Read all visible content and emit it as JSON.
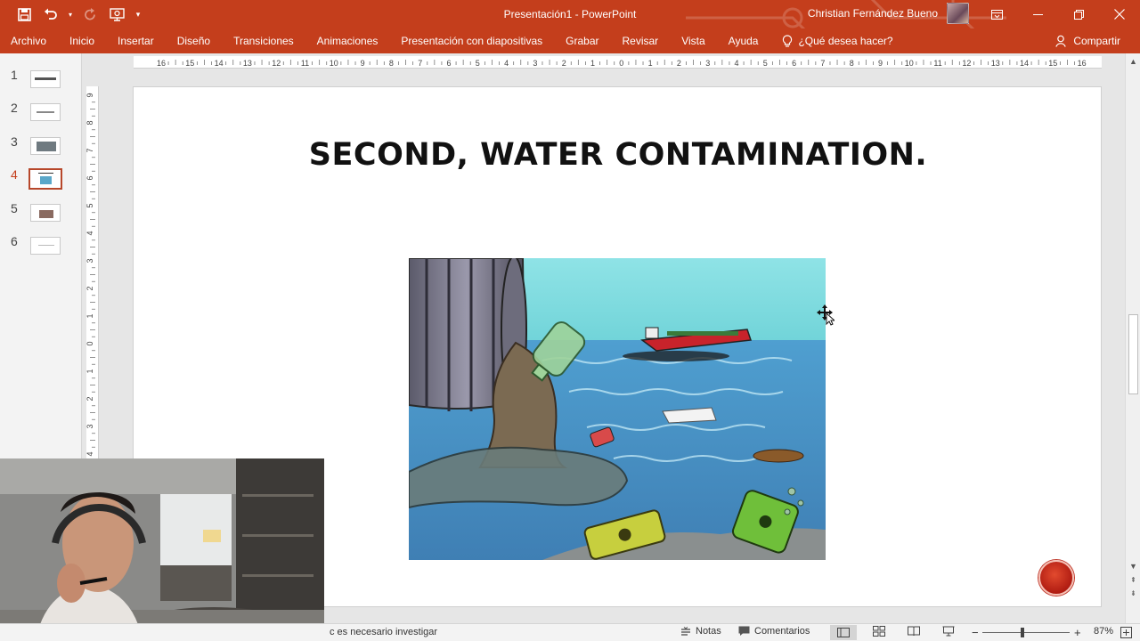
{
  "window": {
    "title": "Presentación1  -  PowerPoint",
    "user_name": "Christian Fernández Bueno"
  },
  "ribbon": {
    "tabs": [
      "Archivo",
      "Inicio",
      "Insertar",
      "Diseño",
      "Transiciones",
      "Animaciones",
      "Presentación con diapositivas",
      "Grabar",
      "Revisar",
      "Vista",
      "Ayuda"
    ],
    "tell_me": "¿Qué desea hacer?",
    "share": "Compartir"
  },
  "thumbnails": {
    "numbers": [
      "1",
      "2",
      "3",
      "4",
      "5",
      "6"
    ],
    "active_index": 4
  },
  "rulers": {
    "horizontal": [
      "16",
      "15",
      "14",
      "13",
      "12",
      "11",
      "10",
      "9",
      "8",
      "7",
      "6",
      "5",
      "4",
      "3",
      "2",
      "1",
      "0",
      "1",
      "2",
      "3",
      "4",
      "5",
      "6",
      "7",
      "8",
      "9",
      "10",
      "11",
      "12",
      "13",
      "14",
      "15",
      "16"
    ],
    "vertical": [
      "9",
      "8",
      "7",
      "6",
      "5",
      "4",
      "3",
      "2",
      "1",
      "0",
      "1",
      "2",
      "3",
      "4"
    ]
  },
  "slide": {
    "title": "SECOND, WATER CONTAMINATION."
  },
  "statusbar": {
    "text": "c es necesario investigar",
    "notes": "Notas",
    "comments": "Comentarios",
    "zoom": "87%"
  },
  "colors": {
    "accent": "#c43e1c",
    "record": "#c0392b"
  }
}
